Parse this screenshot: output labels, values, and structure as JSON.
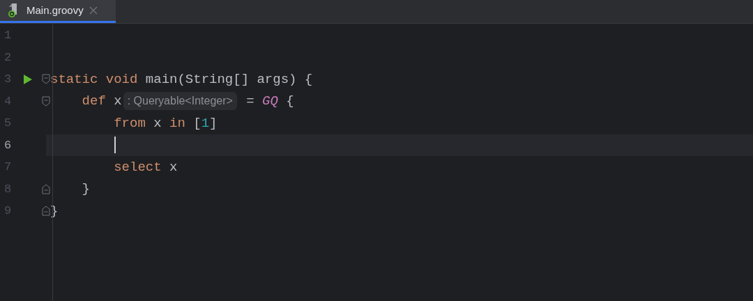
{
  "tab": {
    "label": "Main.groovy",
    "selected": true
  },
  "lines": [
    {
      "number": "1",
      "current": false,
      "run": false,
      "fold_start": false,
      "fold_end": false,
      "caret": false
    },
    {
      "number": "2",
      "current": false,
      "run": false,
      "fold_start": false,
      "fold_end": false,
      "caret": false
    },
    {
      "number": "3",
      "current": false,
      "run": true,
      "fold_start": true,
      "fold_end": false,
      "caret": false,
      "tokens": [
        {
          "kind": "keyword",
          "text": "static void"
        },
        {
          "kind": "plain",
          "text": " main(String[] args) {"
        }
      ]
    },
    {
      "number": "4",
      "current": false,
      "run": false,
      "fold_start": true,
      "fold_end": false,
      "caret": false,
      "tokens": [
        {
          "kind": "keyword",
          "text": "    def"
        },
        {
          "kind": "plain",
          "text": " x"
        },
        {
          "kind": "hint",
          "text": ": Queryable<Integer>"
        },
        {
          "kind": "plain",
          "text": " = "
        },
        {
          "kind": "macro",
          "text": "GQ"
        },
        {
          "kind": "plain",
          "text": " {"
        }
      ]
    },
    {
      "number": "5",
      "current": false,
      "run": false,
      "fold_start": false,
      "fold_end": false,
      "caret": false,
      "tokens": [
        {
          "kind": "keyword",
          "text": "        from"
        },
        {
          "kind": "plain",
          "text": " x "
        },
        {
          "kind": "keyword",
          "text": "in"
        },
        {
          "kind": "plain",
          "text": " ["
        },
        {
          "kind": "number",
          "text": "1"
        },
        {
          "kind": "plain",
          "text": "]"
        }
      ]
    },
    {
      "number": "6",
      "current": true,
      "run": false,
      "fold_start": false,
      "fold_end": false,
      "caret": true
    },
    {
      "number": "7",
      "current": false,
      "run": false,
      "fold_start": false,
      "fold_end": false,
      "caret": false,
      "tokens": [
        {
          "kind": "keyword",
          "text": "        select"
        },
        {
          "kind": "plain",
          "text": " x"
        }
      ]
    },
    {
      "number": "8",
      "current": false,
      "run": false,
      "fold_start": false,
      "fold_end": true,
      "caret": false,
      "tokens": [
        {
          "kind": "plain",
          "text": "    }"
        }
      ]
    },
    {
      "number": "9",
      "current": false,
      "run": false,
      "fold_start": false,
      "fold_end": true,
      "caret": false,
      "tokens": [
        {
          "kind": "plain",
          "text": "}"
        }
      ]
    }
  ]
}
